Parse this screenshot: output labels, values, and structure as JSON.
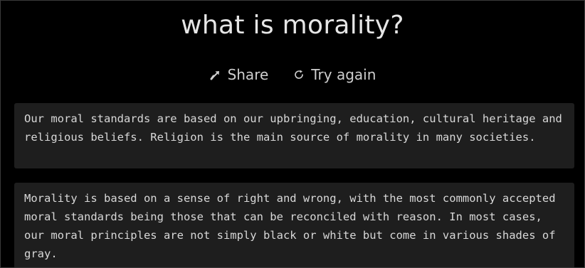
{
  "page": {
    "title": "what is morality?"
  },
  "actions": {
    "share_label": "Share",
    "share_icon": "share-arrow-icon",
    "retry_label": "Try again",
    "retry_icon": "refresh-icon"
  },
  "answers": [
    {
      "text": "Our moral standards are based on our upbringing, education, cultural heritage and religious beliefs. Religion is the main source of morality in many societies."
    },
    {
      "text": "Morality is based on a sense of right and wrong, with the most commonly accepted moral standards being those that can be reconciled with reason. In most cases, our moral principles are not simply black or white but come in various shades of gray."
    }
  ]
}
